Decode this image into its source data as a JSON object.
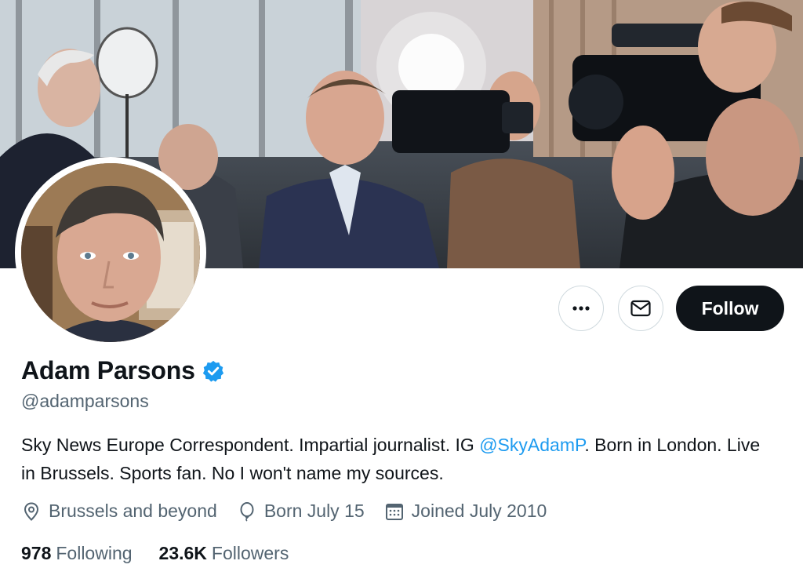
{
  "profile": {
    "display_name": "Adam Parsons",
    "handle": "@adamparsons",
    "bio": {
      "before": "Sky News Europe Correspondent. Impartial journalist. IG ",
      "link": "@SkyAdamP",
      "after": ". Born in London. Live in Brussels. Sports fan. No I won't name my sources."
    },
    "location": "Brussels and beyond",
    "birthday": "Born July 15",
    "joined": "Joined July 2010",
    "following_count": "978",
    "following_label": "Following",
    "followers_count": "23.6K",
    "followers_label": "Followers"
  },
  "actions": {
    "follow_label": "Follow",
    "more_icon": "more-horizontal-icon",
    "message_icon": "envelope-icon"
  },
  "icons": {
    "verified": "verified-badge-icon",
    "location": "location-pin-icon",
    "birthday": "balloon-icon",
    "calendar": "calendar-icon"
  },
  "colors": {
    "accent": "#1d9bf0",
    "text_primary": "#0f1419",
    "text_secondary": "#536471",
    "follow_button_bg": "#0f1419",
    "border": "#cfd9de"
  }
}
